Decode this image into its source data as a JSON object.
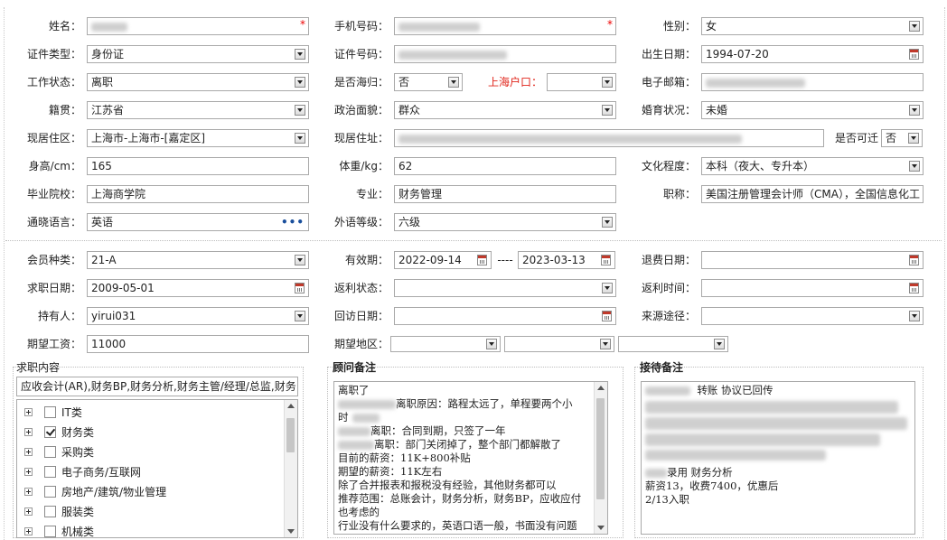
{
  "row1": {
    "name_label": "姓名：",
    "mobile_label": "手机号码：",
    "gender_label": "性别：",
    "gender_value": "女"
  },
  "row2": {
    "idtype_label": "证件类型：",
    "idtype_value": "身份证",
    "idno_label": "证件号码：",
    "birth_label": "出生日期：",
    "birth_value": "1994-07-20"
  },
  "row3": {
    "workstatus_label": "工作状态：",
    "workstatus_value": "离职",
    "returnee_label": "是否海归：",
    "returnee_value": "否",
    "hukou_label": "上海户口：",
    "email_label": "电子邮箱："
  },
  "row4": {
    "native_label": "籍贯：",
    "native_value": "江苏省",
    "political_label": "政治面貌：",
    "political_value": "群众",
    "marital_label": "婚育状况：",
    "marital_value": "未婚"
  },
  "row5": {
    "district_label": "现居住区：",
    "district_value": "上海市-上海市-[嘉定区]",
    "address_label": "现居住址：",
    "relocate_label": "是否可迁",
    "relocate_value": "否"
  },
  "row6": {
    "height_label": "身高/cm：",
    "height_value": "165",
    "weight_label": "体重/kg：",
    "weight_value": "62",
    "edu_label": "文化程度：",
    "edu_value": "本科（夜大、专升本）"
  },
  "row7": {
    "school_label": "毕业院校：",
    "school_value": "上海商学院",
    "major_label": "专业：",
    "major_value": "财务管理",
    "title_label": "职称：",
    "title_value": "美国注册管理会计师（CMA），全国信息化工"
  },
  "row8": {
    "lang_label": "通晓语言：",
    "lang_value": "英语",
    "foreign_label": "外语等级：",
    "foreign_value": "六级"
  },
  "member": {
    "type_label": "会员种类：",
    "type_value": "21-A",
    "valid_label": "有效期：",
    "valid_from": "2022-09-14",
    "valid_sep": "----",
    "valid_to": "2023-03-13",
    "refund_label": "退费日期：",
    "jobdate_label": "求职日期：",
    "jobdate_value": "2009-05-01",
    "rebate_status_label": "返利状态：",
    "rebate_time_label": "返利时间：",
    "holder_label": "持有人：",
    "holder_value": "yirui031",
    "visit_label": "回访日期：",
    "source_label": "来源途径：",
    "salary_label": "期望工资：",
    "salary_value": "11000",
    "region_label": "期望地区："
  },
  "job": {
    "title": "求职内容",
    "selected": "应收会计(AR),财务BP,财务分析,财务主管/经理/总监,财务",
    "tree": [
      {
        "label": "IT类",
        "checked": false
      },
      {
        "label": "财务类",
        "checked": true
      },
      {
        "label": "采购类",
        "checked": false
      },
      {
        "label": "电子商务/互联网",
        "checked": false
      },
      {
        "label": "房地产/建筑/物业管理",
        "checked": false
      },
      {
        "label": "服装类",
        "checked": false
      },
      {
        "label": "机械类",
        "checked": false
      }
    ]
  },
  "consultant": {
    "title": "顾问备注",
    "lines": [
      "离职了",
      "离职原因：路程太远了，单程要两个小",
      "时",
      "离职：合同到期，只签了一年",
      "离职：部门关闭掉了，整个部门都解散了",
      "目前的薪资：11K+800补贴",
      "期望的薪资：11K左右",
      "除了合并报表和报税没有经验，其他财务都可以",
      "推荐范围：总账会计，财务分析，财务BP，应收应付",
      "也考虑的",
      "行业没有什么要求的，英语口语一般，书面没有问题"
    ]
  },
  "reception": {
    "title": "接待备注",
    "lines": [
      "转账 协议已回传",
      "录用 财务分析",
      "薪资13，收费7400，优惠后",
      "2/13入职"
    ]
  },
  "colors": {
    "required": "#e00000",
    "hukou_red": "#e0251b",
    "border": "#a9a9a9"
  }
}
